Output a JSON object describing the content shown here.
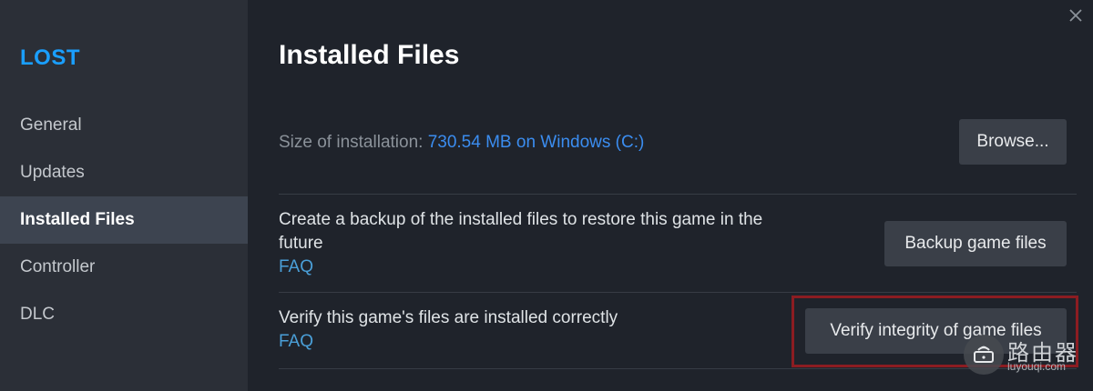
{
  "sidebar": {
    "title": "LOST",
    "items": [
      {
        "label": "General",
        "active": false
      },
      {
        "label": "Updates",
        "active": false
      },
      {
        "label": "Installed Files",
        "active": true
      },
      {
        "label": "Controller",
        "active": false
      },
      {
        "label": "DLC",
        "active": false
      }
    ]
  },
  "window": {
    "close_icon": "close-icon"
  },
  "main": {
    "title": "Installed Files",
    "size": {
      "label": "Size of installation: ",
      "value": "730.54 MB on Windows (C:)",
      "button": "Browse..."
    },
    "backup": {
      "text_line1": "Create a backup of the installed files to restore this game in the",
      "text_line2": "future",
      "faq": "FAQ",
      "button": "Backup game files"
    },
    "verify": {
      "text": "Verify this game's files are installed correctly",
      "faq": "FAQ",
      "button": "Verify integrity of game files"
    }
  },
  "annotation": {
    "highlight_color": "#8c1c22"
  },
  "watermark": {
    "text": "路由器",
    "subtext": "luyouqi.com"
  },
  "colors": {
    "accent": "#1a9fff",
    "link": "#4a9fd8",
    "size_value": "#3b8df0"
  }
}
